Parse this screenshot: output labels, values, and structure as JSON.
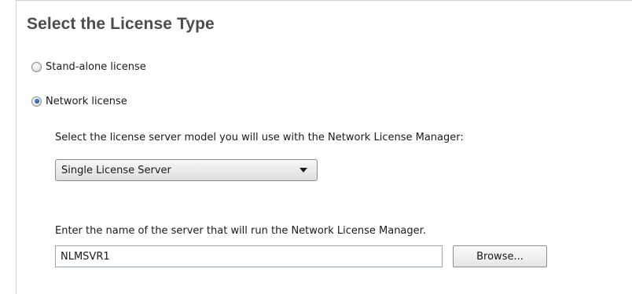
{
  "dialog": {
    "title": "Select the License Type"
  },
  "license_options": [
    {
      "label": "Stand-alone license",
      "selected": false
    },
    {
      "label": "Network license",
      "selected": true
    }
  ],
  "network": {
    "server_model_prompt": "Select the license server model you will use with the Network License Manager:",
    "server_model_selected": "Single License Server",
    "server_name_prompt": "Enter the name of the server that will run the Network License Manager.",
    "server_name_value": "NLMSVR1",
    "browse_label": "Browse..."
  },
  "icons": {
    "dropdown": "chevron-down-icon"
  }
}
